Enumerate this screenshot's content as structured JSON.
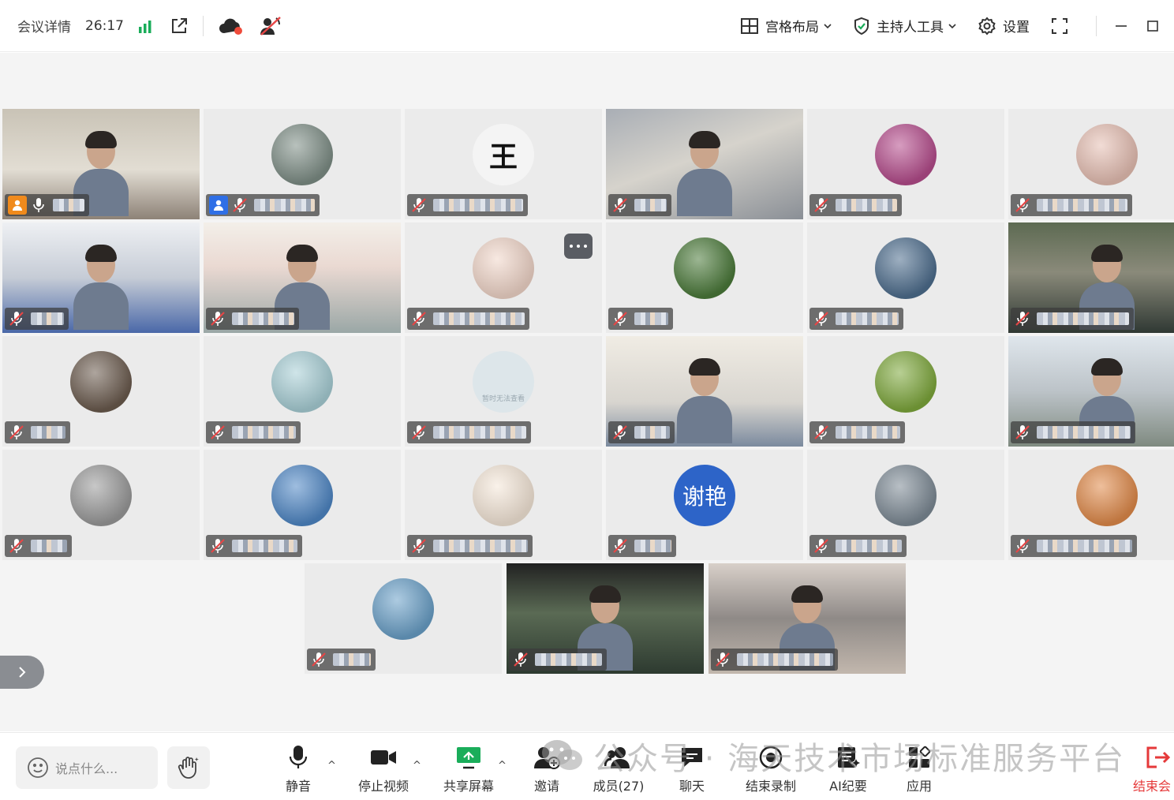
{
  "window": {
    "meeting_details_label": "会议详情",
    "duration": "26:17"
  },
  "toolbar": {
    "layout_label": "宫格布局",
    "host_tools_label": "主持人工具",
    "settings_label": "设置"
  },
  "participants": [
    {
      "kind": "video",
      "host": "orange",
      "mic": "on"
    },
    {
      "kind": "avatar",
      "host": "blue",
      "mic": "muted",
      "avatar_color": "#7e8e86"
    },
    {
      "kind": "avatar",
      "mic": "muted",
      "avatar_color": "#f4f4f4",
      "avatar_text": "王"
    },
    {
      "kind": "video",
      "mic": "muted"
    },
    {
      "kind": "avatar",
      "mic": "muted",
      "avatar_color": "#b54c8c"
    },
    {
      "kind": "avatar",
      "mic": "muted",
      "avatar_color": "#e6bfb3"
    },
    {
      "kind": "video",
      "mic": "muted"
    },
    {
      "kind": "video",
      "mic": "muted"
    },
    {
      "kind": "avatar",
      "mic": "muted",
      "avatar_color": "#f1d6c9",
      "more": true
    },
    {
      "kind": "avatar",
      "mic": "muted",
      "avatar_color": "#4b7a3a"
    },
    {
      "kind": "avatar",
      "mic": "muted",
      "avatar_color": "#4e6e8e"
    },
    {
      "kind": "video",
      "mic": "muted"
    },
    {
      "kind": "avatar",
      "mic": "muted",
      "avatar_color": "#6b5b4e"
    },
    {
      "kind": "avatar",
      "mic": "muted",
      "avatar_color": "#a8cfd6"
    },
    {
      "kind": "avatar",
      "mic": "muted",
      "avatar_color": "#dde6ea",
      "avatar_caption": "暂时无法查看"
    },
    {
      "kind": "video",
      "mic": "muted"
    },
    {
      "kind": "avatar",
      "mic": "muted",
      "avatar_color": "#7ea83c"
    },
    {
      "kind": "video",
      "mic": "muted"
    },
    {
      "kind": "avatar",
      "mic": "muted",
      "avatar_color": "#9a9a9a"
    },
    {
      "kind": "avatar",
      "mic": "muted",
      "avatar_color": "#4f87c5"
    },
    {
      "kind": "avatar",
      "mic": "muted",
      "avatar_color": "#f5e7d8"
    },
    {
      "kind": "avatar",
      "mic": "muted",
      "avatar_color": "#2d64c8",
      "avatar_text": "谢艳"
    },
    {
      "kind": "avatar",
      "mic": "muted",
      "avatar_color": "#7d8a95"
    },
    {
      "kind": "avatar",
      "mic": "muted",
      "avatar_color": "#e08a4a"
    },
    {
      "kind": "avatar",
      "mic": "muted",
      "avatar_color": "#6aa0c8"
    },
    {
      "kind": "video",
      "mic": "muted"
    },
    {
      "kind": "video",
      "mic": "muted"
    }
  ],
  "bottom": {
    "chat_placeholder": "说点什么...",
    "controls": [
      {
        "id": "mute",
        "label": "静音",
        "icon": "microphone-icon"
      },
      {
        "id": "video",
        "label": "停止视频",
        "icon": "camera-icon"
      },
      {
        "id": "share",
        "label": "共享屏幕",
        "icon": "screen-share-icon"
      },
      {
        "id": "invite",
        "label": "邀请",
        "icon": "invite-icon"
      },
      {
        "id": "members",
        "label": "成员(27)",
        "icon": "members-icon"
      },
      {
        "id": "chat",
        "label": "聊天",
        "icon": "chat-icon"
      },
      {
        "id": "record",
        "label": "结束录制",
        "icon": "record-icon"
      },
      {
        "id": "ai",
        "label": "AI纪要",
        "icon": "ai-notes-icon"
      },
      {
        "id": "apps",
        "label": "应用",
        "icon": "apps-icon"
      },
      {
        "id": "end",
        "label": "结束会",
        "icon": "exit-icon"
      }
    ]
  },
  "watermark": {
    "text": "公众号 · 海天技术市场标准服务平台"
  },
  "colors": {
    "accent_green": "#1aad5a",
    "avatar_blue": "#2d64c8",
    "danger_red": "#e5393a",
    "host_orange": "#f08a1c",
    "host_blue": "#2f6fe6",
    "muted_red": "#e64646"
  }
}
